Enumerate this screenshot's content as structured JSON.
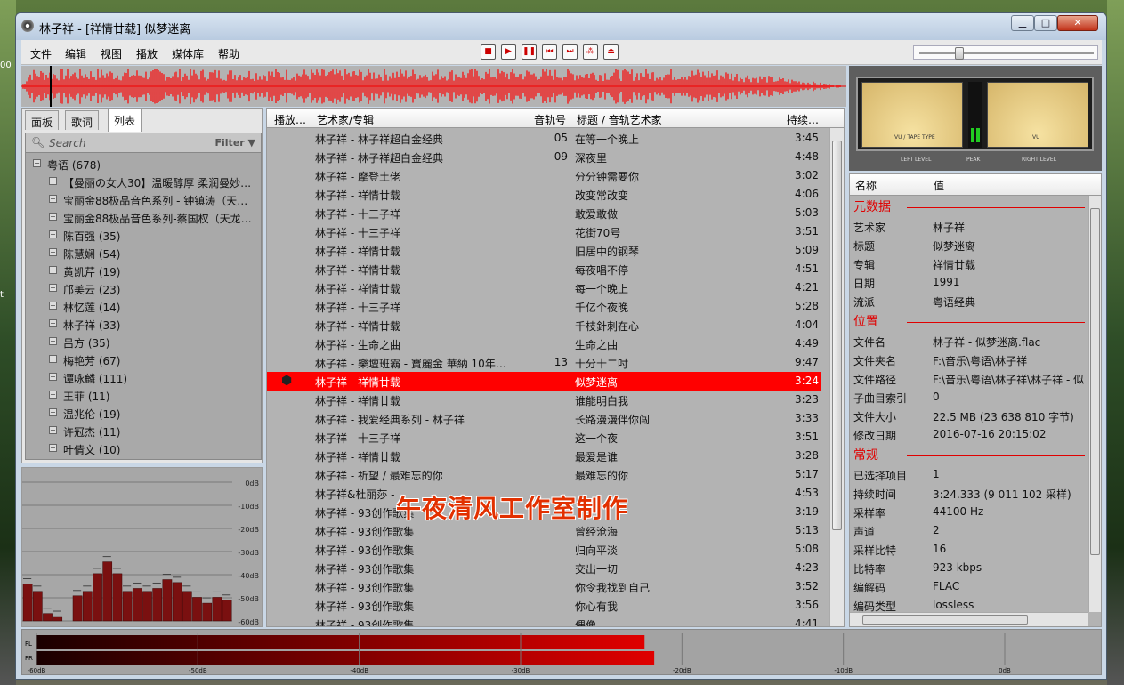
{
  "window": {
    "title": "林子祥 - [祥情廿载] 似梦迷离",
    "min": "▁",
    "max": "□",
    "close": "✕"
  },
  "desktop": {
    "left_text": "00",
    "left_text2": "t"
  },
  "menu": [
    "文件",
    "编辑",
    "视图",
    "播放",
    "媒体库",
    "帮助"
  ],
  "toolbar": {
    "buttons": [
      {
        "name": "stop-icon",
        "glyph": "■"
      },
      {
        "name": "play-icon",
        "glyph": "▶"
      },
      {
        "name": "pause-icon",
        "glyph": "❚❚"
      },
      {
        "name": "prev-icon",
        "glyph": "⏮"
      },
      {
        "name": "next-icon",
        "glyph": "⏭"
      },
      {
        "name": "random-icon",
        "glyph": "⁂"
      },
      {
        "name": "eject-icon",
        "glyph": "⏏"
      }
    ]
  },
  "volume": {
    "level": 0.23
  },
  "left_tabs": [
    "面板",
    "歌词",
    "列表"
  ],
  "left_active_tab": "列表",
  "search": {
    "placeholder": "Search",
    "filter": "Filter ▼",
    "icon": "search-icon"
  },
  "tree": [
    {
      "label": "粤语 (678)",
      "exp": "−",
      "indent": 0
    },
    {
      "label": "【曼丽の女人30】温暖醇厚 柔润曼妙…",
      "exp": "+",
      "indent": 1
    },
    {
      "label": "宝丽金88极品音色系列 - 钟镇涛（天…",
      "exp": "+",
      "indent": 1
    },
    {
      "label": "宝丽金88极品音色系列-蔡国权（天龙…",
      "exp": "+",
      "indent": 1
    },
    {
      "label": "陈百强 (35)",
      "exp": "+",
      "indent": 1
    },
    {
      "label": "陈慧娴 (54)",
      "exp": "+",
      "indent": 1
    },
    {
      "label": "黄凯芹 (19)",
      "exp": "+",
      "indent": 1
    },
    {
      "label": "邝美云 (23)",
      "exp": "+",
      "indent": 1
    },
    {
      "label": "林忆莲 (14)",
      "exp": "+",
      "indent": 1
    },
    {
      "label": "林子祥 (33)",
      "exp": "+",
      "indent": 1
    },
    {
      "label": "吕方 (35)",
      "exp": "+",
      "indent": 1
    },
    {
      "label": "梅艳芳 (67)",
      "exp": "+",
      "indent": 1
    },
    {
      "label": "谭咏麟 (111)",
      "exp": "+",
      "indent": 1
    },
    {
      "label": "王菲 (11)",
      "exp": "+",
      "indent": 1
    },
    {
      "label": "温兆伦 (19)",
      "exp": "+",
      "indent": 1
    },
    {
      "label": "许冠杰 (11)",
      "exp": "+",
      "indent": 1
    },
    {
      "label": "叶倩文 (10)",
      "exp": "+",
      "indent": 1
    }
  ],
  "spectrum": {
    "db_labels": [
      "0dB",
      "-10dB",
      "-20dB",
      "-30dB",
      "-40dB",
      "-50dB",
      "-60dB"
    ],
    "bars": [
      0.25,
      0.2,
      0.05,
      0.03,
      0,
      0.17,
      0.2,
      0.32,
      0.4,
      0.32,
      0.2,
      0.22,
      0.2,
      0.22,
      0.28,
      0.26,
      0.2,
      0.16,
      0.12,
      0.16,
      0.14
    ]
  },
  "playlist": {
    "headers": [
      "播放…",
      "艺术家/专辑",
      "音轨号",
      "标题 / 音轨艺术家",
      "持续…"
    ],
    "rows": [
      {
        "album": "林子祥 - 林子祥超白金经典",
        "track": "05",
        "title": "在等一个晚上",
        "dur": "3:45"
      },
      {
        "album": "林子祥 - 林子祥超白金经典",
        "track": "09",
        "title": "深夜里",
        "dur": "4:48"
      },
      {
        "album": "林子祥 - 摩登土佬",
        "track": "",
        "title": "分分钟需要你",
        "dur": "3:02"
      },
      {
        "album": "林子祥 - 祥情廿载",
        "track": "",
        "title": "改变常改变",
        "dur": "4:06"
      },
      {
        "album": "林子祥 - 十三子祥",
        "track": "",
        "title": "敢爱敢做",
        "dur": "5:03"
      },
      {
        "album": "林子祥 - 十三子祥",
        "track": "",
        "title": "花街70号",
        "dur": "3:51"
      },
      {
        "album": "林子祥 - 祥情廿载",
        "track": "",
        "title": "旧居中的钢琴",
        "dur": "5:09"
      },
      {
        "album": "林子祥 - 祥情廿载",
        "track": "",
        "title": "每夜唱不停",
        "dur": "4:51"
      },
      {
        "album": "林子祥 - 祥情廿载",
        "track": "",
        "title": "每一个晚上",
        "dur": "4:21"
      },
      {
        "album": "林子祥 - 十三子祥",
        "track": "",
        "title": "千亿个夜晚",
        "dur": "5:28"
      },
      {
        "album": "林子祥 - 祥情廿载",
        "track": "",
        "title": "千枝針刺在心",
        "dur": "4:04"
      },
      {
        "album": "林子祥 - 生命之曲",
        "track": "",
        "title": "生命之曲",
        "dur": "4:49"
      },
      {
        "album": "林子祥 - 樂壇班霸 - 寶麗金 華納 10年…",
        "track": "13",
        "title": "十分十二吋",
        "dur": "9:47"
      },
      {
        "album": "林子祥 - 祥情廿载",
        "track": "",
        "title": "似梦迷离",
        "dur": "3:24",
        "selected": true
      },
      {
        "album": "林子祥 - 祥情廿载",
        "track": "",
        "title": "谁能明白我",
        "dur": "3:23"
      },
      {
        "album": "林子祥 - 我爱经典系列 - 林子祥",
        "track": "",
        "title": "长路漫漫伴你闯",
        "dur": "3:33"
      },
      {
        "album": "林子祥 - 十三子祥",
        "track": "",
        "title": "这一个夜",
        "dur": "3:51"
      },
      {
        "album": "林子祥 - 祥情廿载",
        "track": "",
        "title": "最爱是谁",
        "dur": "3:28"
      },
      {
        "album": "林子祥 - 祈望 / 最难忘的你",
        "track": "",
        "title": "最难忘的你",
        "dur": "5:17"
      },
      {
        "album": "林子祥&杜丽莎 -",
        "track": "",
        "title": "",
        "dur": "4:53"
      },
      {
        "album": "林子祥 - 93创作歌集",
        "track": "",
        "title": "",
        "dur": "3:19"
      },
      {
        "album": "林子祥 - 93创作歌集",
        "track": "",
        "title": "曾经沧海",
        "dur": "5:13"
      },
      {
        "album": "林子祥 - 93创作歌集",
        "track": "",
        "title": "归向平淡",
        "dur": "5:08"
      },
      {
        "album": "林子祥 - 93创作歌集",
        "track": "",
        "title": "交出一切",
        "dur": "4:23"
      },
      {
        "album": "林子祥 - 93创作歌集",
        "track": "",
        "title": "你令我找到自己",
        "dur": "3:52"
      },
      {
        "album": "林子祥 - 93创作歌集",
        "track": "",
        "title": "你心有我",
        "dur": "3:56"
      },
      {
        "album": "林子祥 - 93创作歌集",
        "track": "",
        "title": "偶像",
        "dur": "4:41"
      }
    ]
  },
  "vu": {
    "left": "LEFT LEVEL",
    "mid": "PEAK",
    "right": "RIGHT LEVEL",
    "face_l": "VU / TAPE TYPE",
    "face_r": "VU"
  },
  "props": {
    "headers": [
      "名称",
      "值"
    ],
    "sections": [
      {
        "title": "元数据",
        "rows": [
          [
            "艺术家",
            "林子祥"
          ],
          [
            "标题",
            "似梦迷离"
          ],
          [
            "专辑",
            "祥情廿载"
          ],
          [
            "日期",
            "1991"
          ],
          [
            "流派",
            "粤语经典"
          ]
        ]
      },
      {
        "title": "位置",
        "rows": [
          [
            "文件名",
            "林子祥 - 似梦迷离.flac"
          ],
          [
            "文件夹名",
            "F:\\音乐\\粤语\\林子祥"
          ],
          [
            "文件路径",
            "F:\\音乐\\粤语\\林子祥\\林子祥 - 似"
          ],
          [
            "子曲目索引",
            "0"
          ],
          [
            "文件大小",
            "22.5 MB (23 638 810 字节)"
          ],
          [
            "修改日期",
            "2016-07-16 20:15:02"
          ]
        ]
      },
      {
        "title": "常规",
        "rows": [
          [
            "已选择项目",
            "1"
          ],
          [
            "持续时间",
            "3:24.333 (9 011 102 采样)"
          ],
          [
            "采样率",
            "44100 Hz"
          ],
          [
            "声道",
            "2"
          ],
          [
            "采样比特",
            "16"
          ],
          [
            "比特率",
            "923 kbps"
          ],
          [
            "编解码",
            "FLAC"
          ],
          [
            "编码类型",
            "lossless"
          ]
        ]
      }
    ]
  },
  "meter": {
    "fl": "FL",
    "fr": "FR",
    "fl_level": 0.628,
    "fr_level": 0.638,
    "scale": [
      "-60dB",
      "-50dB",
      "-40dB",
      "-30dB",
      "-20dB",
      "-10dB",
      "0dB"
    ]
  },
  "watermark": "午夜清风工作室制作"
}
